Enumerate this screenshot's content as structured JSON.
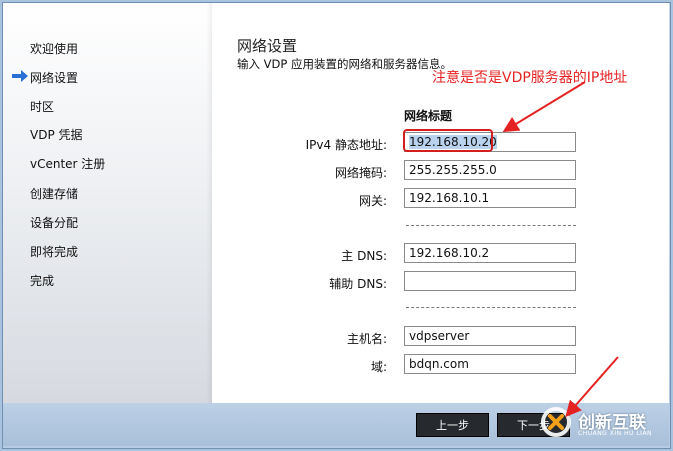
{
  "sidebar": {
    "items": [
      {
        "label": "欢迎使用"
      },
      {
        "label": "网络设置",
        "active": true
      },
      {
        "label": "时区"
      },
      {
        "label": "VDP 凭据"
      },
      {
        "label": "vCenter 注册"
      },
      {
        "label": "创建存储"
      },
      {
        "label": "设备分配"
      },
      {
        "label": "即将完成"
      },
      {
        "label": "完成"
      }
    ],
    "active_icon": "right-arrow-icon"
  },
  "main": {
    "title": "网络设置",
    "subtitle": "输入 VDP 应用装置的网络和服务器信息。",
    "annotation": "注意是否是VDP服务器的IP地址",
    "section_title": "网络标题",
    "fields": {
      "ipv4": {
        "label": "IPv4 静态地址:",
        "value": "192.168.10.20"
      },
      "netmask": {
        "label": "网络掩码:",
        "value": "255.255.255.0"
      },
      "gateway": {
        "label": "网关:",
        "value": "192.168.10.1"
      },
      "dns1": {
        "label": "主 DNS:",
        "value": "192.168.10.2"
      },
      "dns2": {
        "label": "辅助 DNS:",
        "value": ""
      },
      "hostname": {
        "label": "主机名:",
        "value": "vdpserver"
      },
      "domain": {
        "label": "域:",
        "value": "bdqn.com"
      }
    }
  },
  "footer": {
    "back_label": "上一步",
    "next_label": "下一步"
  },
  "watermark": {
    "text": "创新互联",
    "subtext": "CHUANG XIN HU LIAN"
  },
  "colors": {
    "annotation_red": "#e52222",
    "active_arrow": "#2a6fd6",
    "button_bg": "#262a2e"
  }
}
